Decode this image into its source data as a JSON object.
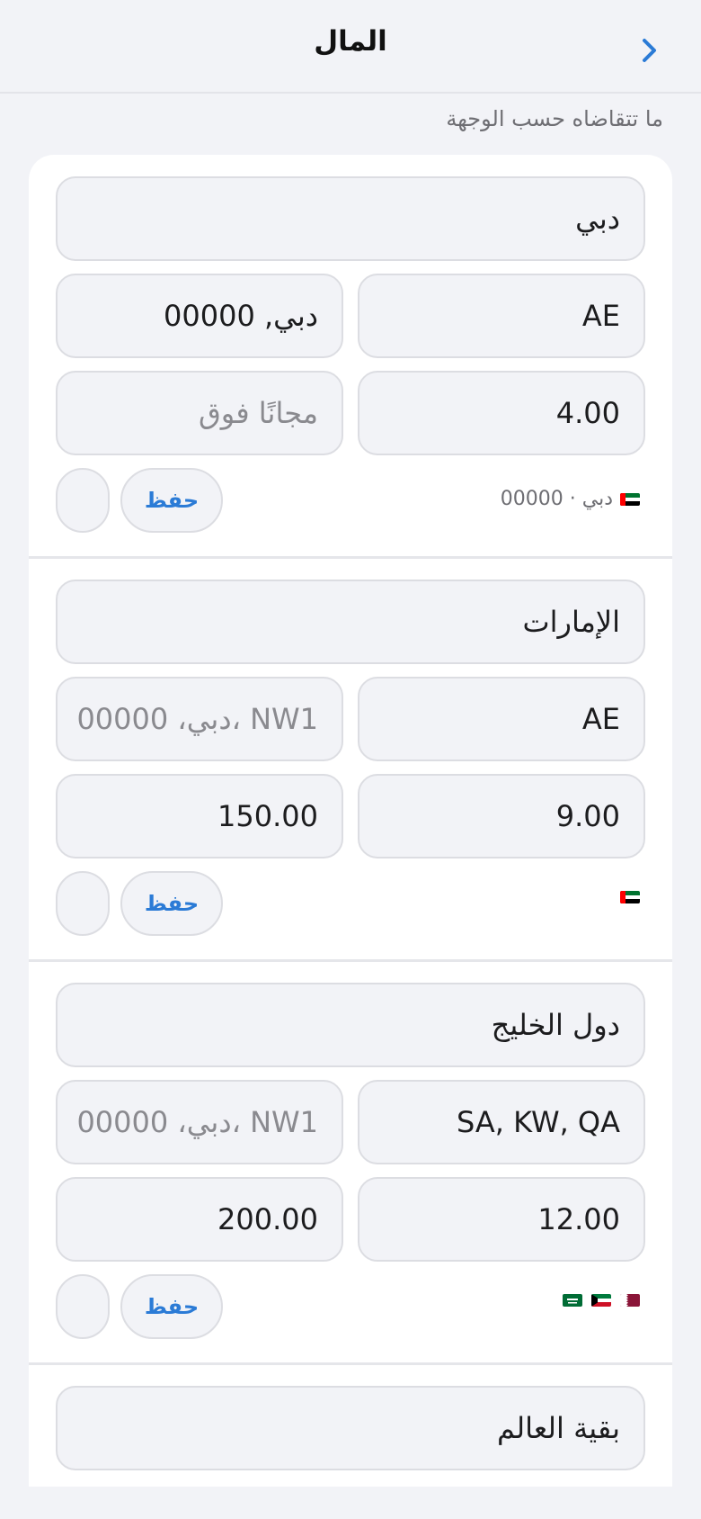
{
  "header": {
    "title": "المال"
  },
  "section_caption": "ما تتقاضاه حسب الوجهة",
  "colors": {
    "accent": "#2b7bd6",
    "background": "#f2f3f7",
    "card": "#ffffff"
  },
  "zones": [
    {
      "name": "دبي",
      "countries": "AE",
      "postcodes": "دبي, 00000",
      "postcodes_is_placeholder": false,
      "rate": "4.00",
      "free_over": "مجانًا فوق",
      "free_over_is_placeholder": true,
      "save_label": "حفظ",
      "summary_text": "دبي · 00000",
      "flags": [
        "ae-flag-icon"
      ]
    },
    {
      "name": "الإمارات",
      "countries": "AE",
      "postcodes": "دبي، 00000، NW1",
      "postcodes_is_placeholder": true,
      "rate": "9.00",
      "free_over": "150.00",
      "free_over_is_placeholder": false,
      "save_label": "حفظ",
      "summary_text": "",
      "flags": [
        "ae-flag-icon"
      ]
    },
    {
      "name": "دول الخليج",
      "countries": "SA, KW, QA",
      "postcodes": "دبي، 00000، NW1",
      "postcodes_is_placeholder": true,
      "rate": "12.00",
      "free_over": "200.00",
      "free_over_is_placeholder": false,
      "save_label": "حفظ",
      "summary_text": "",
      "flags": [
        "sa-flag-icon",
        "kw-flag-icon",
        "qa-flag-icon"
      ]
    },
    {
      "name": "بقية العالم"
    }
  ]
}
